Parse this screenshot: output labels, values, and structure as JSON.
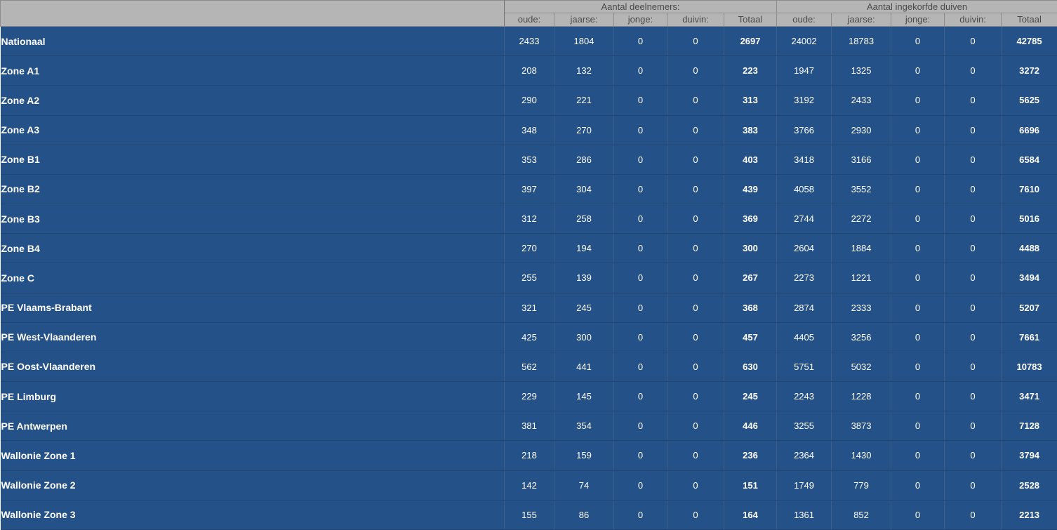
{
  "header": {
    "group_deelnemers": "Aantal deelnemers:",
    "group_duiven": "Aantal ingekorfde duiven",
    "deelnemers_cols": [
      "oude:",
      "jaarse:",
      "jonge:",
      "duivin:",
      "Totaal"
    ],
    "duiven_cols": [
      "oude:",
      "jaarse:",
      "jonge:",
      "duivin:",
      "Totaal"
    ]
  },
  "rows": [
    {
      "name": "Nationaal",
      "deelnemers": [
        "2433",
        "1804",
        "0",
        "0",
        "2697"
      ],
      "duiven": [
        "24002",
        "18783",
        "0",
        "0",
        "42785"
      ]
    },
    {
      "name": "Zone A1",
      "deelnemers": [
        "208",
        "132",
        "0",
        "0",
        "223"
      ],
      "duiven": [
        "1947",
        "1325",
        "0",
        "0",
        "3272"
      ]
    },
    {
      "name": "Zone A2",
      "deelnemers": [
        "290",
        "221",
        "0",
        "0",
        "313"
      ],
      "duiven": [
        "3192",
        "2433",
        "0",
        "0",
        "5625"
      ]
    },
    {
      "name": "Zone A3",
      "deelnemers": [
        "348",
        "270",
        "0",
        "0",
        "383"
      ],
      "duiven": [
        "3766",
        "2930",
        "0",
        "0",
        "6696"
      ]
    },
    {
      "name": "Zone B1",
      "deelnemers": [
        "353",
        "286",
        "0",
        "0",
        "403"
      ],
      "duiven": [
        "3418",
        "3166",
        "0",
        "0",
        "6584"
      ]
    },
    {
      "name": "Zone B2",
      "deelnemers": [
        "397",
        "304",
        "0",
        "0",
        "439"
      ],
      "duiven": [
        "4058",
        "3552",
        "0",
        "0",
        "7610"
      ]
    },
    {
      "name": "Zone B3",
      "deelnemers": [
        "312",
        "258",
        "0",
        "0",
        "369"
      ],
      "duiven": [
        "2744",
        "2272",
        "0",
        "0",
        "5016"
      ]
    },
    {
      "name": "Zone B4",
      "deelnemers": [
        "270",
        "194",
        "0",
        "0",
        "300"
      ],
      "duiven": [
        "2604",
        "1884",
        "0",
        "0",
        "4488"
      ]
    },
    {
      "name": "Zone C",
      "deelnemers": [
        "255",
        "139",
        "0",
        "0",
        "267"
      ],
      "duiven": [
        "2273",
        "1221",
        "0",
        "0",
        "3494"
      ]
    },
    {
      "name": "PE Vlaams-Brabant",
      "deelnemers": [
        "321",
        "245",
        "0",
        "0",
        "368"
      ],
      "duiven": [
        "2874",
        "2333",
        "0",
        "0",
        "5207"
      ]
    },
    {
      "name": "PE West-Vlaanderen",
      "deelnemers": [
        "425",
        "300",
        "0",
        "0",
        "457"
      ],
      "duiven": [
        "4405",
        "3256",
        "0",
        "0",
        "7661"
      ]
    },
    {
      "name": "PE Oost-Vlaanderen",
      "deelnemers": [
        "562",
        "441",
        "0",
        "0",
        "630"
      ],
      "duiven": [
        "5751",
        "5032",
        "0",
        "0",
        "10783"
      ]
    },
    {
      "name": "PE Limburg",
      "deelnemers": [
        "229",
        "145",
        "0",
        "0",
        "245"
      ],
      "duiven": [
        "2243",
        "1228",
        "0",
        "0",
        "3471"
      ]
    },
    {
      "name": "PE Antwerpen",
      "deelnemers": [
        "381",
        "354",
        "0",
        "0",
        "446"
      ],
      "duiven": [
        "3255",
        "3873",
        "0",
        "0",
        "7128"
      ]
    },
    {
      "name": "Wallonie Zone 1",
      "deelnemers": [
        "218",
        "159",
        "0",
        "0",
        "236"
      ],
      "duiven": [
        "2364",
        "1430",
        "0",
        "0",
        "3794"
      ]
    },
    {
      "name": "Wallonie Zone 2",
      "deelnemers": [
        "142",
        "74",
        "0",
        "0",
        "151"
      ],
      "duiven": [
        "1749",
        "779",
        "0",
        "0",
        "2528"
      ]
    },
    {
      "name": "Wallonie Zone 3",
      "deelnemers": [
        "155",
        "86",
        "0",
        "0",
        "164"
      ],
      "duiven": [
        "1361",
        "852",
        "0",
        "0",
        "2213"
      ]
    }
  ]
}
